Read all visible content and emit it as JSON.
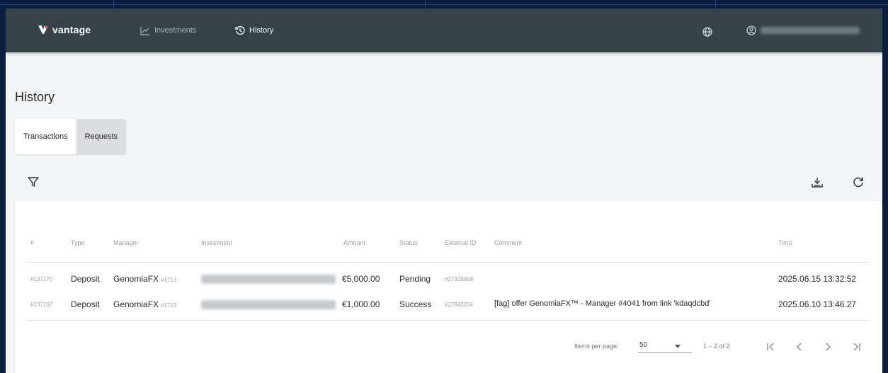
{
  "nav": {
    "brand": "vantage",
    "investments": "Investments",
    "history": "History",
    "icons": [
      "chart-icon",
      "history-icon",
      "globe-icon",
      "user-icon"
    ]
  },
  "page": {
    "title": "History"
  },
  "tabs": [
    {
      "label": "Transactions"
    },
    {
      "label": "Requests"
    }
  ],
  "table": {
    "headers": [
      "#",
      "Type",
      "Manager",
      "Investment",
      "Amount",
      "Status",
      "External ID",
      "Comment",
      "Time"
    ],
    "rows": [
      {
        "id": "#137170",
        "type": "Deposit",
        "manager": "GenomiaFX",
        "manager_id": "#1713",
        "amount": "€5,000.00",
        "status": "Pending",
        "external_id": "#27928958",
        "comment": "",
        "time": "2025.06.15 13:32:52"
      },
      {
        "id": "#137107",
        "type": "Deposit",
        "manager": "GenomiaFX",
        "manager_id": "#1713",
        "amount": "€1,000.00",
        "status": "Success",
        "external_id": "#27642204",
        "comment": "[fag] offer GenomiaFX™ - Manager #4041 from link 'kdaqdcbd'",
        "time": "2025.06.10 13:46.27"
      }
    ]
  },
  "pagination": {
    "items_per_page_label": "Items per page:",
    "items_per_page": "50",
    "range": "1 – 2 of 2"
  },
  "colors": {
    "topbar": "#354349",
    "page_bg": "#f4f5f6",
    "outer_bg": "#0b1d3f",
    "active_tab": "#dcdde0"
  }
}
